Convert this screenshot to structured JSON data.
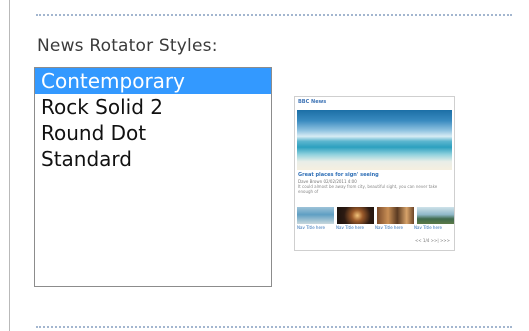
{
  "section": {
    "label": "News Rotator Styles:"
  },
  "styles": {
    "options": [
      "Contemporary",
      "Rock Solid 2",
      "Round Dot",
      "Standard"
    ],
    "selected": "Contemporary"
  },
  "preview": {
    "title": "BBC News",
    "headline": "Great places for sign' seeing",
    "meta": "Dave Brown 02/02/2011 4:00",
    "body": "It could almost be away from city, beautiful sight, you can never take enough of",
    "thumb_captions": [
      "Nav Title here",
      "Nav Title here",
      "Nav Title here",
      "Nav Title here"
    ],
    "pager": "<<  1/4  >>|  >>>"
  },
  "colors": {
    "selection": "#3399ff",
    "dotted_rule": "#a3b6cf"
  }
}
